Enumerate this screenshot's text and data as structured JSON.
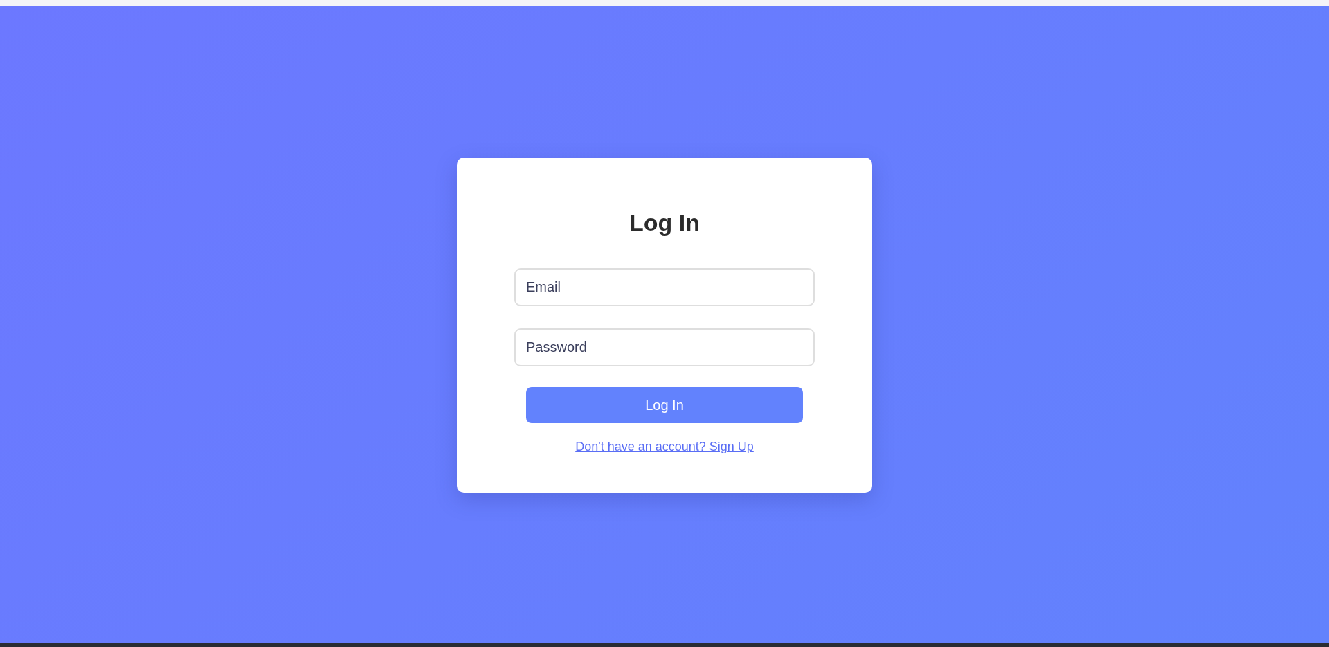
{
  "form": {
    "title": "Log In",
    "fields": [
      {
        "placeholder": "Email"
      },
      {
        "placeholder": "Password"
      }
    ],
    "submit": "Log In",
    "signup_link": "Don't have an account? Sign Up"
  }
}
